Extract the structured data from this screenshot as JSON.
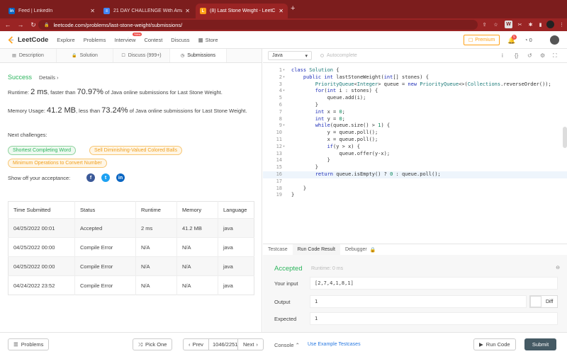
{
  "browser": {
    "tabs": [
      {
        "title": "Feed | LinkedIn",
        "icon": "linkedin-icon",
        "color": "#0a66c2",
        "glyph": "in"
      },
      {
        "title": "21 DAY CHALLENGE With Ama",
        "icon": "doc-icon",
        "color": "#4285f4",
        "glyph": "≡"
      },
      {
        "title": "(8) Last Stone Weight - LeetC",
        "icon": "leetcode-icon",
        "color": "#ffa116",
        "glyph": "L"
      }
    ],
    "url": "leetcode.com/problems/last-stone-weight/submissions/"
  },
  "nav": {
    "logo": "LeetCode",
    "links": [
      "Explore",
      "Problems",
      "Interview",
      "Contest",
      "Discuss"
    ],
    "new_badge": "New",
    "store": "Store",
    "premium": "Premium",
    "notifications": "5",
    "coins": "0"
  },
  "left_tabs": [
    {
      "label": "Description",
      "icon": "description-icon",
      "glyph": "▤"
    },
    {
      "label": "Solution",
      "icon": "lock-icon",
      "glyph": "🔒"
    },
    {
      "label": "Discuss (999+)",
      "icon": "discuss-icon",
      "glyph": "☐"
    },
    {
      "label": "Submissions",
      "icon": "history-icon",
      "glyph": "◷"
    }
  ],
  "result": {
    "status": "Success",
    "details": "Details",
    "runtime_label": "Runtime: ",
    "runtime_value": "2 ms",
    "runtime_mid": ", faster than ",
    "runtime_pct": "70.97%",
    "runtime_tail": " of Java online submissions for Last Stone Weight.",
    "memory_label": "Memory Usage: ",
    "memory_value": "41.2 MB",
    "memory_mid": ", less than ",
    "memory_pct": "73.24%",
    "memory_tail": " of Java online submissions for Last Stone Weight.",
    "next_challenges": "Next challenges:",
    "challenges": [
      "Shortest Completing Word",
      "Sell Diminishing-Valued Colored Balls",
      "Minimum Operations to Convert Number"
    ],
    "share": "Show off your acceptance:"
  },
  "submissions": {
    "headers": [
      "Time Submitted",
      "Status",
      "Runtime",
      "Memory",
      "Language"
    ],
    "rows": [
      {
        "time": "04/25/2022 00:01",
        "status": "Accepted",
        "runtime": "2 ms",
        "memory": "41.2 MB",
        "language": "java"
      },
      {
        "time": "04/25/2022 00:00",
        "status": "Compile Error",
        "runtime": "N/A",
        "memory": "N/A",
        "language": "java"
      },
      {
        "time": "04/25/2022 00:00",
        "status": "Compile Error",
        "runtime": "N/A",
        "memory": "N/A",
        "language": "java"
      },
      {
        "time": "04/24/2022 23:52",
        "status": "Compile Error",
        "runtime": "N/A",
        "memory": "N/A",
        "language": "java"
      }
    ]
  },
  "editor": {
    "language": "Java",
    "autocomplete": "Autocomplete",
    "lines": [
      "class Solution {",
      "    public int lastStoneWeight(int[] stones) {",
      "        PriorityQueue<Integer> queue = new PriorityQueue<>(Collections.reverseOrder());",
      "        for(int i : stones) {",
      "            queue.add(i);",
      "        }",
      "        int x = 0;",
      "        int y = 0;",
      "        while(queue.size() > 1) {",
      "            y = queue.poll();",
      "            x = queue.poll();",
      "            if(y > x) {",
      "                queue.offer(y-x);",
      "            }",
      "        }",
      "        return queue.isEmpty() ? 0 : queue.poll();",
      "",
      "    }",
      "}"
    ],
    "folds": [
      1,
      2,
      4,
      9,
      12
    ]
  },
  "console": {
    "tabs": [
      "Testcase",
      "Run Code Result",
      "Debugger"
    ],
    "status": "Accepted",
    "runtime": "Runtime: 0 ms",
    "your_input_label": "Your input",
    "your_input": "[2,7,4,1,8,1]",
    "output_label": "Output",
    "output": "1",
    "expected_label": "Expected",
    "expected": "1",
    "diff": "Diff"
  },
  "footer": {
    "problems": "Problems",
    "pick_one": "Pick One",
    "prev": "Prev",
    "page": "1046/2251",
    "next": "Next",
    "console": "Console",
    "example": "Use Example Testcases",
    "run_code": "Run Code",
    "submit": "Submit"
  }
}
